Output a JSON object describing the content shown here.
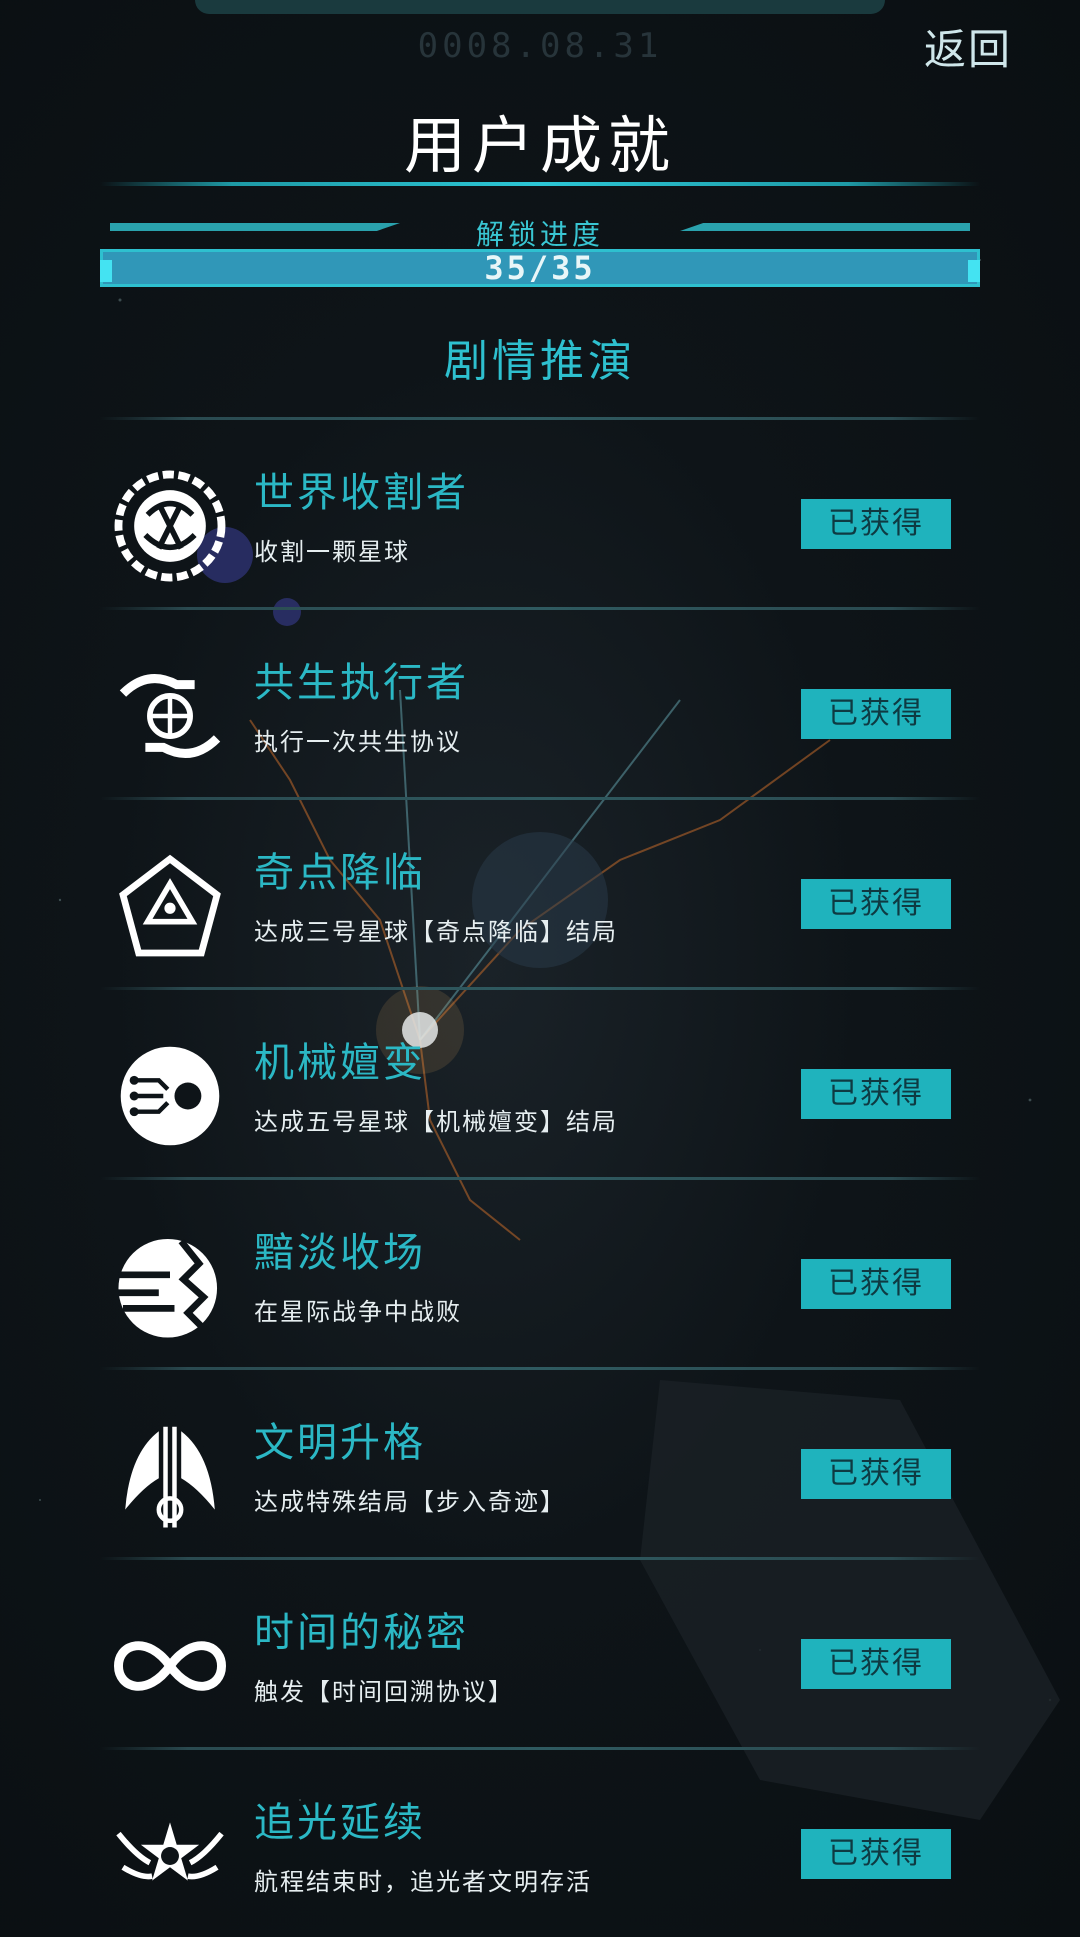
{
  "header": {
    "timestamp": "0008.08.31",
    "back_label": "返回",
    "title": "用户成就"
  },
  "progress": {
    "label": "解锁进度",
    "value_text": "35/35",
    "fraction": 1.0
  },
  "section": {
    "title": "剧情推演"
  },
  "achievements": [
    {
      "name": "世界收割者",
      "description": "收割一颗星球",
      "status": "已获得",
      "icon": "planet-harvester-icon"
    },
    {
      "name": "共生执行者",
      "description": "执行一次共生协议",
      "status": "已获得",
      "icon": "hand-globe-icon"
    },
    {
      "name": "奇点降临",
      "description": "达成三号星球【奇点降临】结局",
      "status": "已获得",
      "icon": "triangle-cycle-icon"
    },
    {
      "name": "机械嬗变",
      "description": "达成五号星球【机械嬗变】结局",
      "status": "已获得",
      "icon": "circuit-eye-icon"
    },
    {
      "name": "黯淡收场",
      "description": "在星际战争中战败",
      "status": "已获得",
      "icon": "shattered-planet-icon"
    },
    {
      "name": "文明升格",
      "description": "达成特殊结局【步入奇迹】",
      "status": "已获得",
      "icon": "winged-emblem-icon"
    },
    {
      "name": "时间的秘密",
      "description": "触发【时间回溯协议】",
      "status": "已获得",
      "icon": "infinity-icon"
    },
    {
      "name": "追光延续",
      "description": "航程结束时，追光者文明存活",
      "status": "已获得",
      "icon": "winged-star-icon"
    }
  ],
  "colors": {
    "accent": "#2bb8c5",
    "badge_bg": "#1fb3bd",
    "background": "#0e1418"
  }
}
